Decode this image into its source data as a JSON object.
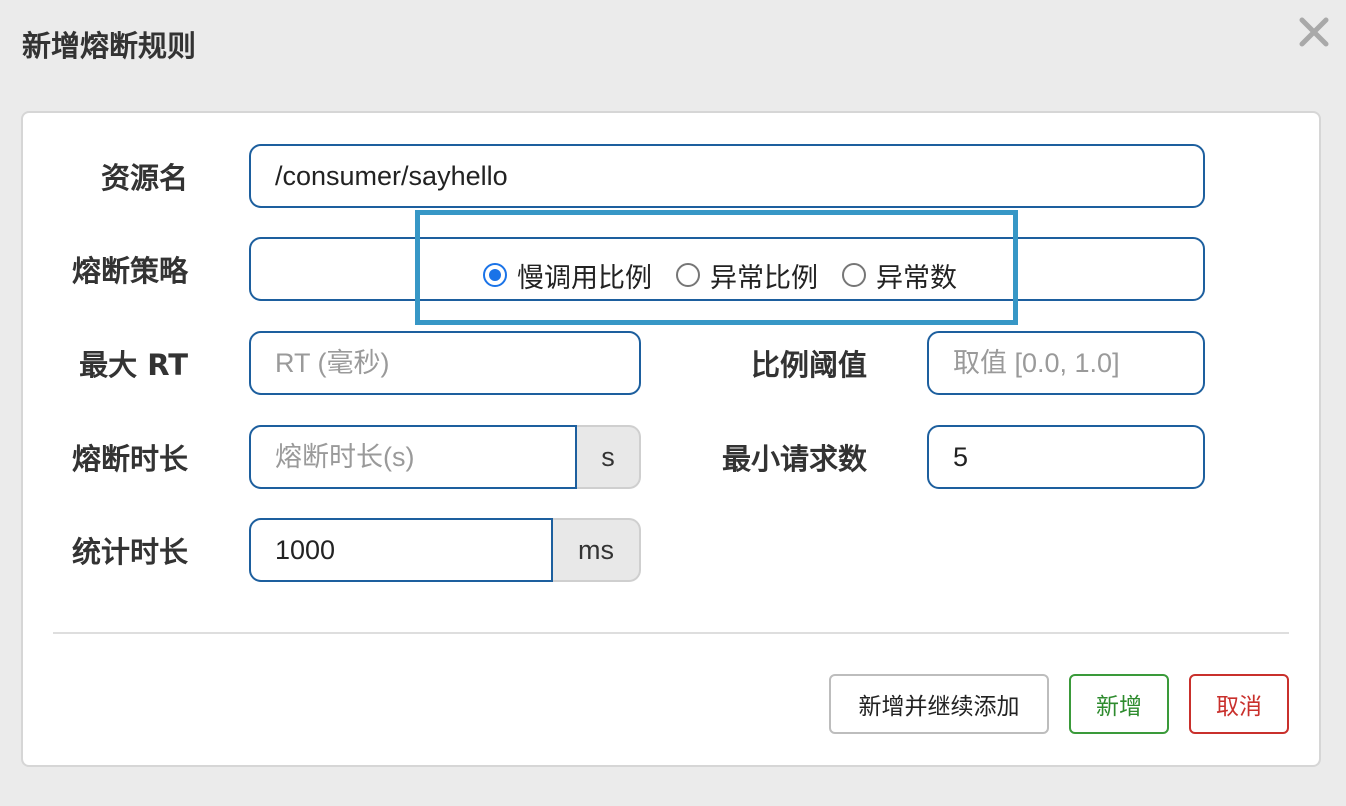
{
  "dialog": {
    "title": "新增熔断规则"
  },
  "form": {
    "resource": {
      "label": "资源名",
      "value": "/consumer/sayhello"
    },
    "strategy": {
      "label": "熔断策略",
      "options": [
        "慢调用比例",
        "异常比例",
        "异常数"
      ],
      "selected": "慢调用比例"
    },
    "max_rt": {
      "label": "最大 RT",
      "placeholder": "RT (毫秒)",
      "value": ""
    },
    "ratio": {
      "label": "比例阈值",
      "placeholder": "取值 [0.0, 1.0]",
      "value": ""
    },
    "duration": {
      "label": "熔断时长",
      "placeholder": "熔断时长(s)",
      "value": "",
      "unit": "s"
    },
    "min_requests": {
      "label": "最小请求数",
      "value": "5"
    },
    "stat_interval": {
      "label": "统计时长",
      "value": "1000",
      "unit": "ms"
    }
  },
  "footer": {
    "add_continue_label": "新增并继续添加",
    "add_label": "新增",
    "cancel_label": "取消"
  },
  "colors": {
    "input_border": "#1d5f9e",
    "highlight": "#3797c6",
    "radio_checked": "#1a73e8",
    "add_button": "#3a9a3a",
    "cancel_button": "#c9302c"
  },
  "icons": {
    "close": "close-icon"
  }
}
